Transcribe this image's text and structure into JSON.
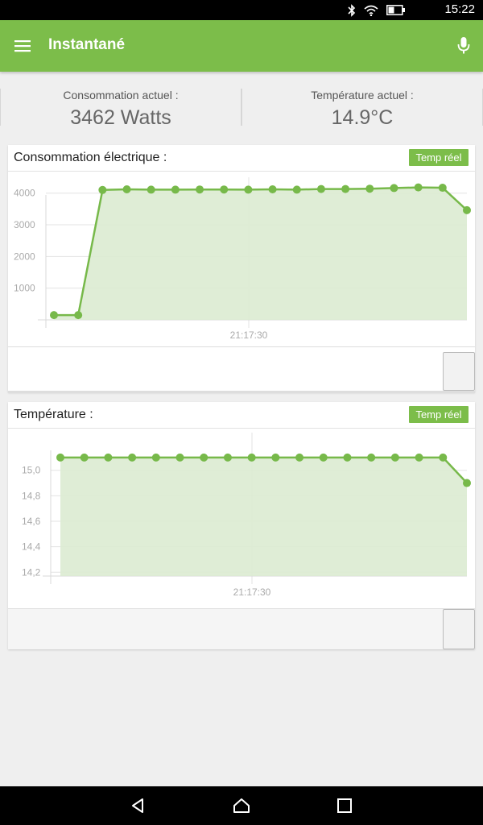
{
  "status_bar": {
    "time": "15:22",
    "icons": [
      "bluetooth-icon",
      "wifi-icon",
      "battery-icon"
    ]
  },
  "app_bar": {
    "title": "Instantané",
    "menu_icon": "menu-icon",
    "mic_icon": "mic-icon"
  },
  "summary": {
    "consumption_label": "Consommation actuel :",
    "consumption_value": "3462 Watts",
    "temperature_label": "Température actuel :",
    "temperature_value": "14.9°C"
  },
  "cards": [
    {
      "title": "Consommation électrique :",
      "button": "Temp réel"
    },
    {
      "title": "Température :",
      "button": "Temp réel"
    }
  ],
  "colors": {
    "accent": "#7cbd4a",
    "fill": "#dcebd1",
    "line": "#77b94a"
  },
  "chart_data": [
    {
      "type": "area",
      "title": "Consommation électrique :",
      "x_tick_labels": [
        "21:17:30"
      ],
      "y_tick_labels": [
        "1000",
        "2000",
        "3000",
        "4000"
      ],
      "ylim": [
        0,
        4400
      ],
      "grid": true,
      "series": [
        {
          "values": [
            150,
            150,
            4100,
            4120,
            4110,
            4110,
            4115,
            4115,
            4110,
            4120,
            4110,
            4130,
            4130,
            4140,
            4160,
            4180,
            4170,
            3462
          ]
        }
      ]
    },
    {
      "type": "area",
      "title": "Température :",
      "x_tick_labels": [
        "21:17:30"
      ],
      "y_tick_labels": [
        "14,2",
        "14,4",
        "14,6",
        "14,8",
        "15,0"
      ],
      "ylim": [
        14.17,
        15.27
      ],
      "grid": true,
      "series": [
        {
          "values": [
            15.1,
            15.1,
            15.1,
            15.1,
            15.1,
            15.1,
            15.1,
            15.1,
            15.1,
            15.1,
            15.1,
            15.1,
            15.1,
            15.1,
            15.1,
            15.1,
            15.1,
            14.9
          ]
        }
      ]
    }
  ],
  "nav_bar": {
    "icons": [
      "back-icon",
      "home-icon",
      "recents-icon"
    ]
  }
}
